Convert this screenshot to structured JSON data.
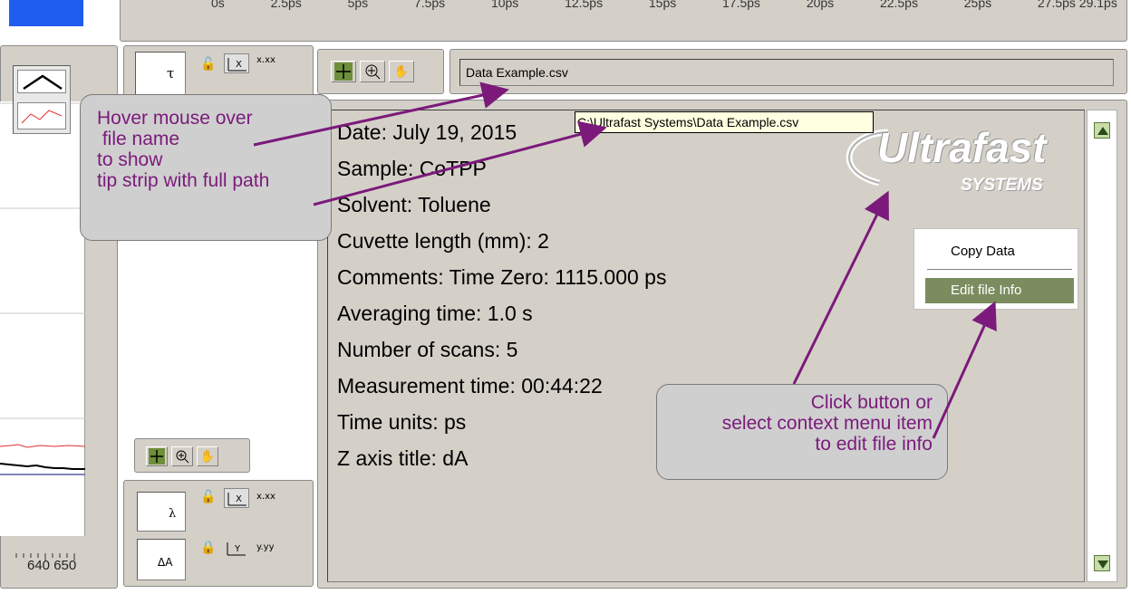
{
  "top_axis_ticks": [
    "0s",
    "2.5ps",
    "5ps",
    "7.5ps",
    "10ps",
    "12.5ps",
    "15ps",
    "17.5ps",
    "20ps",
    "22.5ps",
    "25ps",
    "27.5ps 29.1ps"
  ],
  "left_plot": {
    "tick_labels": "640 650",
    "legend_icons": [
      "peak-line-icon",
      "red-wave-icon"
    ]
  },
  "kinetics_axis_panel": {
    "field_label": "τ",
    "format_label": "x.xx"
  },
  "spectra_axis_panel": {
    "x_field_label": "λ",
    "x_format_label": "x.xx",
    "y_field_label": "ΔA",
    "y_format_label": "y.yy"
  },
  "tools": [
    "crosshair-tool-icon",
    "zoom-tool-icon",
    "pan-hand-icon"
  ],
  "file_name_field": "Data Example.csv",
  "tooltip": "C:\\Ultrafast Systems\\Data Example.csv",
  "file_info": {
    "date": "Date: July 19, 2015",
    "sample": "Sample: CoTPP",
    "solvent": "Solvent: Toluene",
    "cuvette": "Cuvette length (mm): 2",
    "comments": "Comments: Time Zero: 1115.000 ps",
    "averaging": "Averaging time: 1.0 s",
    "scans": "Number of scans: 5",
    "measurement": "Measurement time: 00:44:22",
    "time_units": "Time units: ps",
    "z_axis": "Z axis title: dA"
  },
  "logo": {
    "main": "Ultrafast",
    "sub": "SYSTEMS"
  },
  "context_menu": {
    "copy": "Copy Data",
    "edit": "Edit file Info"
  },
  "callout_hover": "Hover mouse over\n file name\nto show\ntip strip with full path",
  "callout_click": "Click button or\nselect context menu item\nto edit file info",
  "colors": {
    "annotation": "#7b1a7b",
    "menu_highlight": "#7b8c5f",
    "accent_blue": "#1f5cf0"
  }
}
